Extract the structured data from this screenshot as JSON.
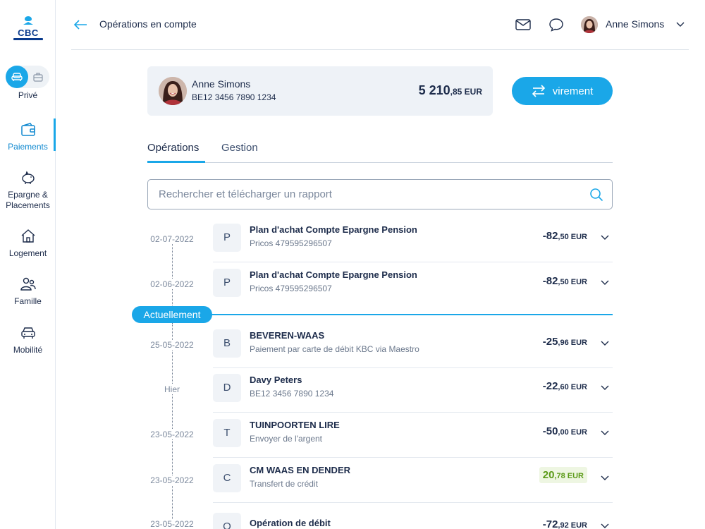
{
  "brand": {
    "logo_text": "CBC",
    "accent": "#1aa7e8",
    "primary": "#1c2b4a",
    "positive": "#5b9a18"
  },
  "sidebar": {
    "mode_label": "Privé",
    "items": [
      {
        "label": "Paiements",
        "icon": "wallet-icon"
      },
      {
        "label": "Epargne & Placements",
        "icon": "piggy-bank-icon"
      },
      {
        "label": "Logement",
        "icon": "house-icon"
      },
      {
        "label": "Famille",
        "icon": "family-icon"
      },
      {
        "label": "Mobilité",
        "icon": "car-icon"
      }
    ]
  },
  "header": {
    "title": "Opérations en compte",
    "user_name": "Anne Simons"
  },
  "account": {
    "name": "Anne Simons",
    "iban": "BE12 3456 7890 1234",
    "balance_main": "5 210",
    "balance_cents": ",85 EUR"
  },
  "virement_label": "virement",
  "tabs": [
    {
      "label": "Opérations"
    },
    {
      "label": "Gestion"
    }
  ],
  "search": {
    "placeholder": "Rechercher et télécharger un rapport"
  },
  "now_label": "Actuellement",
  "transactions": [
    {
      "date": "02-07-2022",
      "letter": "P",
      "title": "Plan d'achat Compte Epargne Pension",
      "sub": "Pricos 479595296507",
      "amount_main": "-82",
      "amount_cents": ",50 EUR"
    },
    {
      "date": "02-06-2022",
      "letter": "P",
      "title": "Plan d'achat Compte Epargne Pension",
      "sub": "Pricos 479595296507",
      "amount_main": "-82",
      "amount_cents": ",50 EUR"
    },
    {
      "date": "25-05-2022",
      "letter": "B",
      "title": "BEVEREN-WAAS",
      "sub": "Paiement par carte de débit KBC via Maestro",
      "amount_main": "-25",
      "amount_cents": ",96 EUR"
    },
    {
      "date": "Hier",
      "letter": "D",
      "title": "Davy Peters",
      "sub": "BE12 3456 7890 1234",
      "amount_main": "-22",
      "amount_cents": ",60 EUR"
    },
    {
      "date": "23-05-2022",
      "letter": "T",
      "title": "TUINPOORTEN LIRE",
      "sub": "Envoyer de l'argent",
      "amount_main": "-50",
      "amount_cents": ",00 EUR"
    },
    {
      "date": "23-05-2022",
      "letter": "C",
      "title": "CM WAAS EN DENDER",
      "sub": "Transfert de crédit",
      "amount_main": "20",
      "amount_cents": ",78 EUR"
    },
    {
      "date": "23-05-2022",
      "letter": "O",
      "title": "Opération de débit",
      "sub": "",
      "amount_main": "-72",
      "amount_cents": ",92 EUR"
    }
  ]
}
